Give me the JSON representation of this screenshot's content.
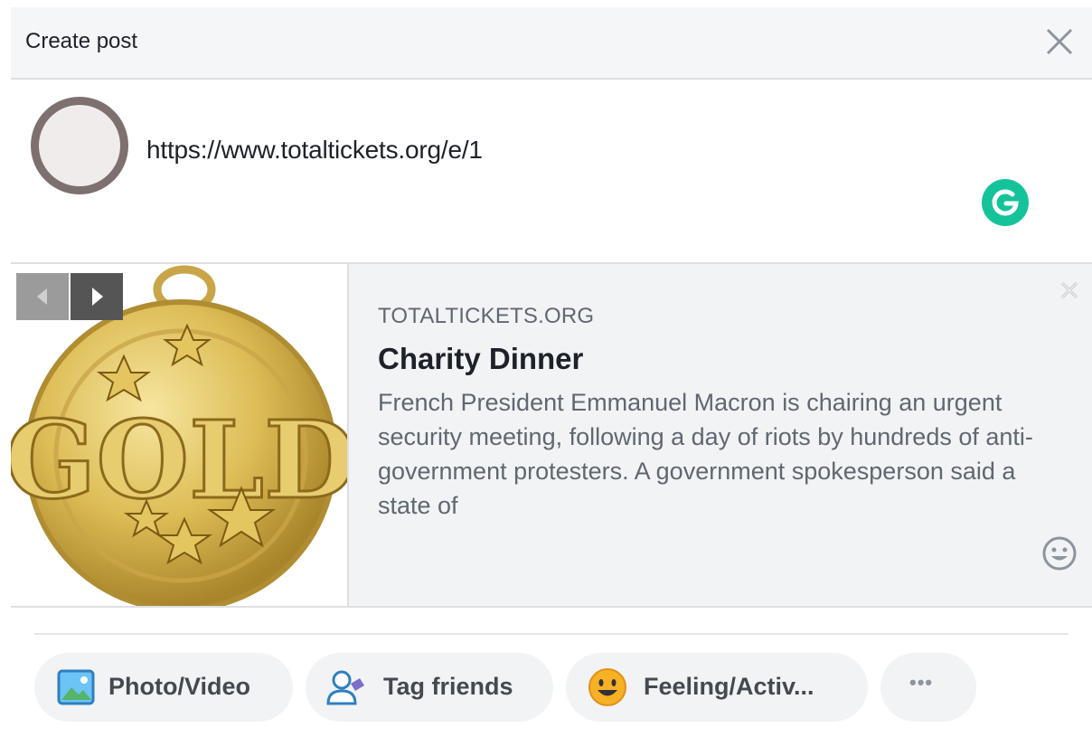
{
  "header": {
    "title": "Create post",
    "close_icon": "close-icon"
  },
  "composer": {
    "text": "https://www.totaltickets.org/e/1",
    "grammarly_icon": "grammarly-icon"
  },
  "link_preview": {
    "domain": "TOTALTICKETS.ORG",
    "title": "Charity Dinner",
    "description": "French President Emmanuel Macron is chairing an urgent security meeting, following a day of riots by hundreds of anti-government protesters. A government spokesperson said a state of",
    "image": "gold-medal-image",
    "image_text": "GOLD",
    "remove_icon": "close-icon",
    "emoji_icon": "smiley-icon"
  },
  "actions": [
    {
      "label": "Photo/Video",
      "icon": "photo-icon"
    },
    {
      "label": "Tag friends",
      "icon": "tag-friends-icon"
    },
    {
      "label": "Feeling/Activ...",
      "icon": "feeling-emoji-icon"
    },
    {
      "label": "•••",
      "icon": "more-icon"
    }
  ],
  "colors": {
    "header_bg": "#f5f6f7",
    "preview_bg": "#f2f3f5",
    "grammarly": "#15c39a",
    "medal_gold": "#d9b74f",
    "pill_bg": "#f2f3f5"
  }
}
